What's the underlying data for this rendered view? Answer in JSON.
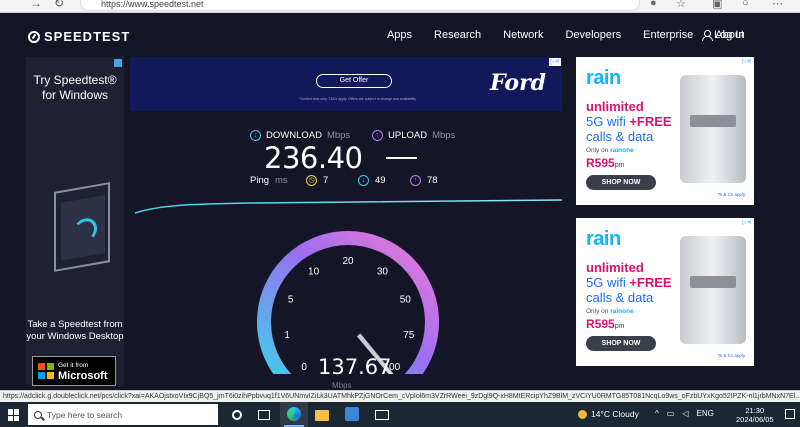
{
  "browser": {
    "url": "https://www.speedtest.net"
  },
  "header": {
    "logo": "SPEEDTEST",
    "nav": [
      "Apps",
      "Research",
      "Network",
      "Developers",
      "Enterprise",
      "About"
    ],
    "login": "Log In"
  },
  "left_ad": {
    "headline": "Try Speedtest® for Windows",
    "subline": "Take a Speedtest from your Windows Desktop",
    "badge_small": "Get it from",
    "badge_big": "Microsoft"
  },
  "top_ad": {
    "button": "Get Offer",
    "fine_print": "*Limited time only. T&Cs apply. Offers are subject to change and availability.",
    "brand": "Ford"
  },
  "speed": {
    "download_label": "DOWNLOAD",
    "upload_label": "UPLOAD",
    "unit": "Mbps",
    "download_value": "236.40",
    "ping_label": "Ping",
    "ping_unit": "ms",
    "ping_idle": "7",
    "ping_download": "49",
    "ping_upload": "78"
  },
  "gauge": {
    "value": "137.67",
    "unit": "Mbps",
    "ticks": [
      "0",
      "1",
      "5",
      "10",
      "20",
      "30",
      "50",
      "75",
      "100"
    ],
    "needle_value": 137.67,
    "accent_start": "#3fd0ea",
    "accent_end": "#c45cf2"
  },
  "rain_ad": {
    "brand": "rain",
    "line1": "unlimited",
    "line2a": "5G wifi ",
    "line2b": "+FREE",
    "line3": "calls & data",
    "only_a": "Only on ",
    "only_b": "rainone",
    "price": "R595",
    "price_suffix": "pm",
    "cta": "SHOP NOW",
    "tc": "Ts & Cs apply."
  },
  "status_url": "https://adclick.g.doubleclick.net/pcs/click?xai=AKAOjstxoVIx9CjBQ5_jmT6i0zihPpbvuq1f1V6UNmvIZiLk3UATMhkPZjGNOrCem_cVpIol6m3VZrRWeei_9zDgl9Q-xH8MtERcipYhZ9BlM_zVCIYU0RMTG85T081NcqLo9ws_oFzbUYxKgo52IPZK-nl1jrbMNxN7El...",
  "taskbar": {
    "search_placeholder": "Type here to search",
    "weather": "14°C  Cloudy",
    "lang": "ENG",
    "time": "21:30",
    "date": "2024/06/05"
  }
}
